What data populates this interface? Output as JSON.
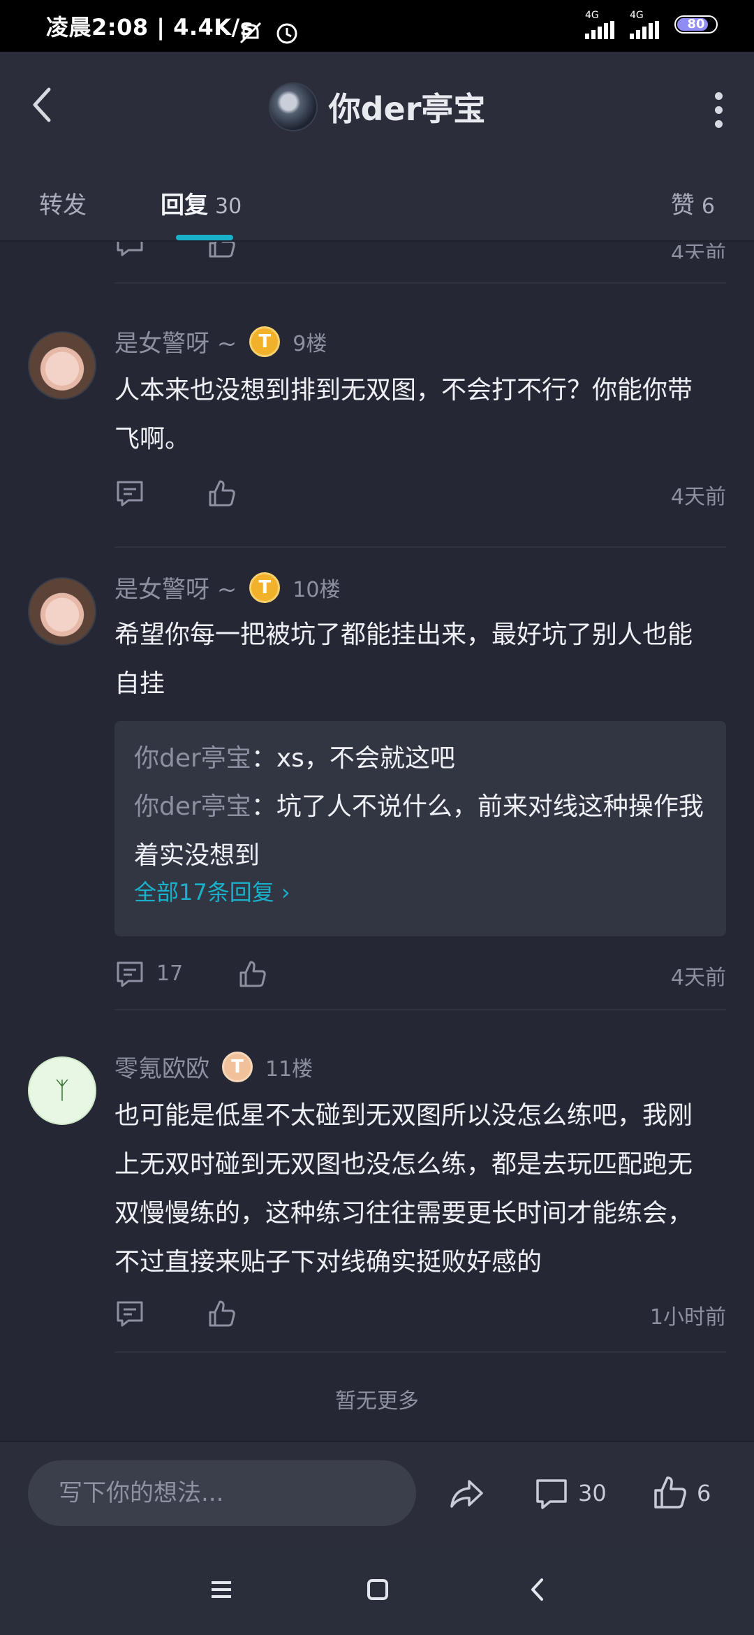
{
  "status": {
    "time": "凌晨2:08 | 4.4K/s",
    "net1": "4G",
    "net2": "4G",
    "battery": "80"
  },
  "header": {
    "title": "你der亭宝"
  },
  "tabs": [
    {
      "label": "转发"
    },
    {
      "label": "回复",
      "count": "30"
    },
    {
      "label": "赞",
      "count": "6"
    }
  ],
  "top_partial": {
    "time": "4天前"
  },
  "comments": [
    {
      "user": "是女警呀 ~",
      "badge": "T",
      "floor": "9楼",
      "text": "人本来也没想到排到无双图，不会打不行？你能你带飞啊。",
      "time": "4天前"
    },
    {
      "user": "是女警呀 ~",
      "badge": "T",
      "floor": "10楼",
      "text": "希望你每一把被坑了都能挂出来，最好坑了别人也能自挂",
      "replies": [
        {
          "name": "你der亭宝",
          "sep": "：",
          "text": "xs，不会就这吧"
        },
        {
          "name": "你der亭宝",
          "sep": "：",
          "text": "坑了人不说什么，前来对线这种操作我着实没想到"
        }
      ],
      "more_replies": "全部17条回复 ›",
      "reply_count": "17",
      "time": "4天前"
    },
    {
      "user": "零氪欧欧",
      "badge": "T",
      "floor": "11楼",
      "text": "也可能是低星不太碰到无双图所以没怎么练吧，我刚上无双时碰到无双图也没怎么练，都是去玩匹配跑无双慢慢练的，这种练习往往需要更长时间才能练会，不过直接来贴子下对线确实挺败好感的",
      "time": "1小时前"
    }
  ],
  "footer_note": "暂无更多",
  "bottom": {
    "placeholder": "写下你的想法...",
    "comments": "30",
    "likes": "6"
  }
}
